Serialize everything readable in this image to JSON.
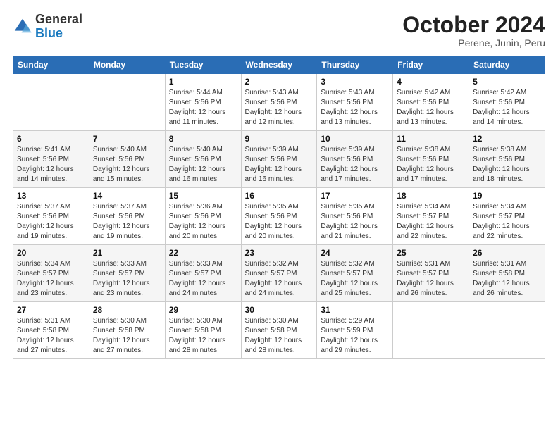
{
  "header": {
    "logo_general": "General",
    "logo_blue": "Blue",
    "month_title": "October 2024",
    "subtitle": "Perene, Junin, Peru"
  },
  "days_of_week": [
    "Sunday",
    "Monday",
    "Tuesday",
    "Wednesday",
    "Thursday",
    "Friday",
    "Saturday"
  ],
  "weeks": [
    [
      {
        "num": "",
        "sunrise": "",
        "sunset": "",
        "daylight": ""
      },
      {
        "num": "",
        "sunrise": "",
        "sunset": "",
        "daylight": ""
      },
      {
        "num": "1",
        "sunrise": "Sunrise: 5:44 AM",
        "sunset": "Sunset: 5:56 PM",
        "daylight": "Daylight: 12 hours and 11 minutes."
      },
      {
        "num": "2",
        "sunrise": "Sunrise: 5:43 AM",
        "sunset": "Sunset: 5:56 PM",
        "daylight": "Daylight: 12 hours and 12 minutes."
      },
      {
        "num": "3",
        "sunrise": "Sunrise: 5:43 AM",
        "sunset": "Sunset: 5:56 PM",
        "daylight": "Daylight: 12 hours and 13 minutes."
      },
      {
        "num": "4",
        "sunrise": "Sunrise: 5:42 AM",
        "sunset": "Sunset: 5:56 PM",
        "daylight": "Daylight: 12 hours and 13 minutes."
      },
      {
        "num": "5",
        "sunrise": "Sunrise: 5:42 AM",
        "sunset": "Sunset: 5:56 PM",
        "daylight": "Daylight: 12 hours and 14 minutes."
      }
    ],
    [
      {
        "num": "6",
        "sunrise": "Sunrise: 5:41 AM",
        "sunset": "Sunset: 5:56 PM",
        "daylight": "Daylight: 12 hours and 14 minutes."
      },
      {
        "num": "7",
        "sunrise": "Sunrise: 5:40 AM",
        "sunset": "Sunset: 5:56 PM",
        "daylight": "Daylight: 12 hours and 15 minutes."
      },
      {
        "num": "8",
        "sunrise": "Sunrise: 5:40 AM",
        "sunset": "Sunset: 5:56 PM",
        "daylight": "Daylight: 12 hours and 16 minutes."
      },
      {
        "num": "9",
        "sunrise": "Sunrise: 5:39 AM",
        "sunset": "Sunset: 5:56 PM",
        "daylight": "Daylight: 12 hours and 16 minutes."
      },
      {
        "num": "10",
        "sunrise": "Sunrise: 5:39 AM",
        "sunset": "Sunset: 5:56 PM",
        "daylight": "Daylight: 12 hours and 17 minutes."
      },
      {
        "num": "11",
        "sunrise": "Sunrise: 5:38 AM",
        "sunset": "Sunset: 5:56 PM",
        "daylight": "Daylight: 12 hours and 17 minutes."
      },
      {
        "num": "12",
        "sunrise": "Sunrise: 5:38 AM",
        "sunset": "Sunset: 5:56 PM",
        "daylight": "Daylight: 12 hours and 18 minutes."
      }
    ],
    [
      {
        "num": "13",
        "sunrise": "Sunrise: 5:37 AM",
        "sunset": "Sunset: 5:56 PM",
        "daylight": "Daylight: 12 hours and 19 minutes."
      },
      {
        "num": "14",
        "sunrise": "Sunrise: 5:37 AM",
        "sunset": "Sunset: 5:56 PM",
        "daylight": "Daylight: 12 hours and 19 minutes."
      },
      {
        "num": "15",
        "sunrise": "Sunrise: 5:36 AM",
        "sunset": "Sunset: 5:56 PM",
        "daylight": "Daylight: 12 hours and 20 minutes."
      },
      {
        "num": "16",
        "sunrise": "Sunrise: 5:35 AM",
        "sunset": "Sunset: 5:56 PM",
        "daylight": "Daylight: 12 hours and 20 minutes."
      },
      {
        "num": "17",
        "sunrise": "Sunrise: 5:35 AM",
        "sunset": "Sunset: 5:56 PM",
        "daylight": "Daylight: 12 hours and 21 minutes."
      },
      {
        "num": "18",
        "sunrise": "Sunrise: 5:34 AM",
        "sunset": "Sunset: 5:57 PM",
        "daylight": "Daylight: 12 hours and 22 minutes."
      },
      {
        "num": "19",
        "sunrise": "Sunrise: 5:34 AM",
        "sunset": "Sunset: 5:57 PM",
        "daylight": "Daylight: 12 hours and 22 minutes."
      }
    ],
    [
      {
        "num": "20",
        "sunrise": "Sunrise: 5:34 AM",
        "sunset": "Sunset: 5:57 PM",
        "daylight": "Daylight: 12 hours and 23 minutes."
      },
      {
        "num": "21",
        "sunrise": "Sunrise: 5:33 AM",
        "sunset": "Sunset: 5:57 PM",
        "daylight": "Daylight: 12 hours and 23 minutes."
      },
      {
        "num": "22",
        "sunrise": "Sunrise: 5:33 AM",
        "sunset": "Sunset: 5:57 PM",
        "daylight": "Daylight: 12 hours and 24 minutes."
      },
      {
        "num": "23",
        "sunrise": "Sunrise: 5:32 AM",
        "sunset": "Sunset: 5:57 PM",
        "daylight": "Daylight: 12 hours and 24 minutes."
      },
      {
        "num": "24",
        "sunrise": "Sunrise: 5:32 AM",
        "sunset": "Sunset: 5:57 PM",
        "daylight": "Daylight: 12 hours and 25 minutes."
      },
      {
        "num": "25",
        "sunrise": "Sunrise: 5:31 AM",
        "sunset": "Sunset: 5:57 PM",
        "daylight": "Daylight: 12 hours and 26 minutes."
      },
      {
        "num": "26",
        "sunrise": "Sunrise: 5:31 AM",
        "sunset": "Sunset: 5:58 PM",
        "daylight": "Daylight: 12 hours and 26 minutes."
      }
    ],
    [
      {
        "num": "27",
        "sunrise": "Sunrise: 5:31 AM",
        "sunset": "Sunset: 5:58 PM",
        "daylight": "Daylight: 12 hours and 27 minutes."
      },
      {
        "num": "28",
        "sunrise": "Sunrise: 5:30 AM",
        "sunset": "Sunset: 5:58 PM",
        "daylight": "Daylight: 12 hours and 27 minutes."
      },
      {
        "num": "29",
        "sunrise": "Sunrise: 5:30 AM",
        "sunset": "Sunset: 5:58 PM",
        "daylight": "Daylight: 12 hours and 28 minutes."
      },
      {
        "num": "30",
        "sunrise": "Sunrise: 5:30 AM",
        "sunset": "Sunset: 5:58 PM",
        "daylight": "Daylight: 12 hours and 28 minutes."
      },
      {
        "num": "31",
        "sunrise": "Sunrise: 5:29 AM",
        "sunset": "Sunset: 5:59 PM",
        "daylight": "Daylight: 12 hours and 29 minutes."
      },
      {
        "num": "",
        "sunrise": "",
        "sunset": "",
        "daylight": ""
      },
      {
        "num": "",
        "sunrise": "",
        "sunset": "",
        "daylight": ""
      }
    ]
  ]
}
